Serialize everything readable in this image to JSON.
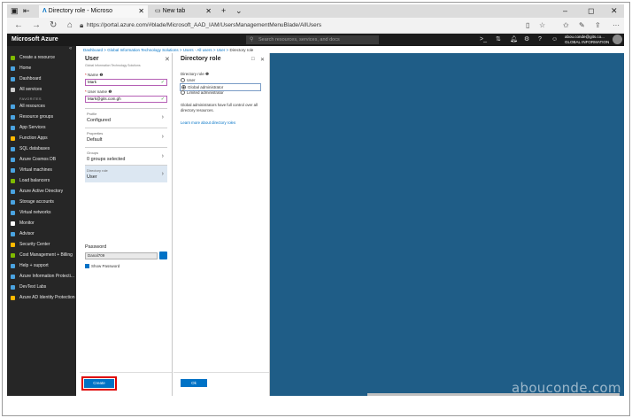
{
  "browser": {
    "tabs": [
      {
        "label": "Directory role - Microso",
        "icon": "azure-icon"
      },
      {
        "label": "New tab",
        "icon": "newtab-icon"
      }
    ],
    "new_tab_glyph": "+",
    "url": "https://portal.azure.com/#blade/Microsoft_AAD_IAM/UsersManagementMenuBlade/AllUsers",
    "window_min": "–",
    "window_max": "◻",
    "window_close": "✕"
  },
  "azure": {
    "brand": "Microsoft Azure",
    "search_placeholder": "Search resources, services, and docs",
    "user_email": "abou.conde@gits.co...",
    "user_org": "GLOBAL INFORMATION TECH..."
  },
  "sidebar": {
    "items": [
      {
        "label": "Create a resource",
        "color": "#7fba00",
        "icon": "plus-icon"
      },
      {
        "label": "Home",
        "color": "#4aa3e0",
        "icon": "home-icon"
      },
      {
        "label": "Dashboard",
        "color": "#4aa3e0",
        "icon": "dashboard-icon"
      },
      {
        "label": "All services",
        "color": "#cccccc",
        "icon": "list-icon"
      },
      {
        "label": "All resources",
        "color": "#4aa3e0",
        "icon": "grid-icon"
      },
      {
        "label": "Resource groups",
        "color": "#4aa3e0",
        "icon": "cube-icon"
      },
      {
        "label": "App Services",
        "color": "#4aa3e0",
        "icon": "globe-icon"
      },
      {
        "label": "Function Apps",
        "color": "#ffb900",
        "icon": "bolt-icon"
      },
      {
        "label": "SQL databases",
        "color": "#4aa3e0",
        "icon": "database-icon"
      },
      {
        "label": "Azure Cosmos DB",
        "color": "#4aa3e0",
        "icon": "cosmos-icon"
      },
      {
        "label": "Virtual machines",
        "color": "#4aa3e0",
        "icon": "vm-icon"
      },
      {
        "label": "Load balancers",
        "color": "#7fba00",
        "icon": "balance-icon"
      },
      {
        "label": "Azure Active Directory",
        "color": "#4aa3e0",
        "icon": "aad-icon"
      },
      {
        "label": "Storage accounts",
        "color": "#4aa3e0",
        "icon": "storage-icon"
      },
      {
        "label": "Virtual networks",
        "color": "#4aa3e0",
        "icon": "network-icon"
      },
      {
        "label": "Monitor",
        "color": "#ffffff",
        "icon": "monitor-icon"
      },
      {
        "label": "Advisor",
        "color": "#4aa3e0",
        "icon": "advisor-icon"
      },
      {
        "label": "Security Center",
        "color": "#ffb900",
        "icon": "shield-icon"
      },
      {
        "label": "Cost Management + Billing",
        "color": "#7fba00",
        "icon": "billing-icon"
      },
      {
        "label": "Help + support",
        "color": "#4aa3e0",
        "icon": "help-icon"
      },
      {
        "label": "Azure Information Protecti...",
        "color": "#4aa3e0",
        "icon": "lock-icon"
      },
      {
        "label": "DevTest Labs",
        "color": "#4aa3e0",
        "icon": "lab-icon"
      },
      {
        "label": "Azure AD Identity Protection",
        "color": "#ffb900",
        "icon": "identity-icon"
      }
    ],
    "favorites": "FAVORITES"
  },
  "breadcrumb": {
    "items": [
      "Dashboard",
      "Global Information Technology Solutions",
      "Users - All users",
      "User",
      "Directory role"
    ],
    "separator": ">"
  },
  "user_blade": {
    "title": "User",
    "subtitle": "Global Information Technology Solutions",
    "name_label": "Name",
    "name_value": "Mark",
    "username_label": "User name",
    "username_value": "Mark@gits.com.gh",
    "sections": [
      {
        "label": "Profile",
        "value": "Configured"
      },
      {
        "label": "Properties",
        "value": "Default"
      },
      {
        "label": "Groups",
        "value": "0 groups selected"
      },
      {
        "label": "Directory role",
        "value": "User"
      }
    ],
    "password_label": "Password",
    "password_value": "Danal709",
    "show_password": "Show Password",
    "create_label": "Create"
  },
  "role_blade": {
    "title": "Directory role",
    "role_label": "Directory role",
    "options": [
      "User",
      "Global administrator",
      "Limited administrator"
    ],
    "selected": "Global administrator",
    "description": "Global administrators have full control over all directory resources.",
    "learn_more": "Learn more about directory roles",
    "ok_label": "Ok"
  },
  "watermark": "abouconde.com"
}
